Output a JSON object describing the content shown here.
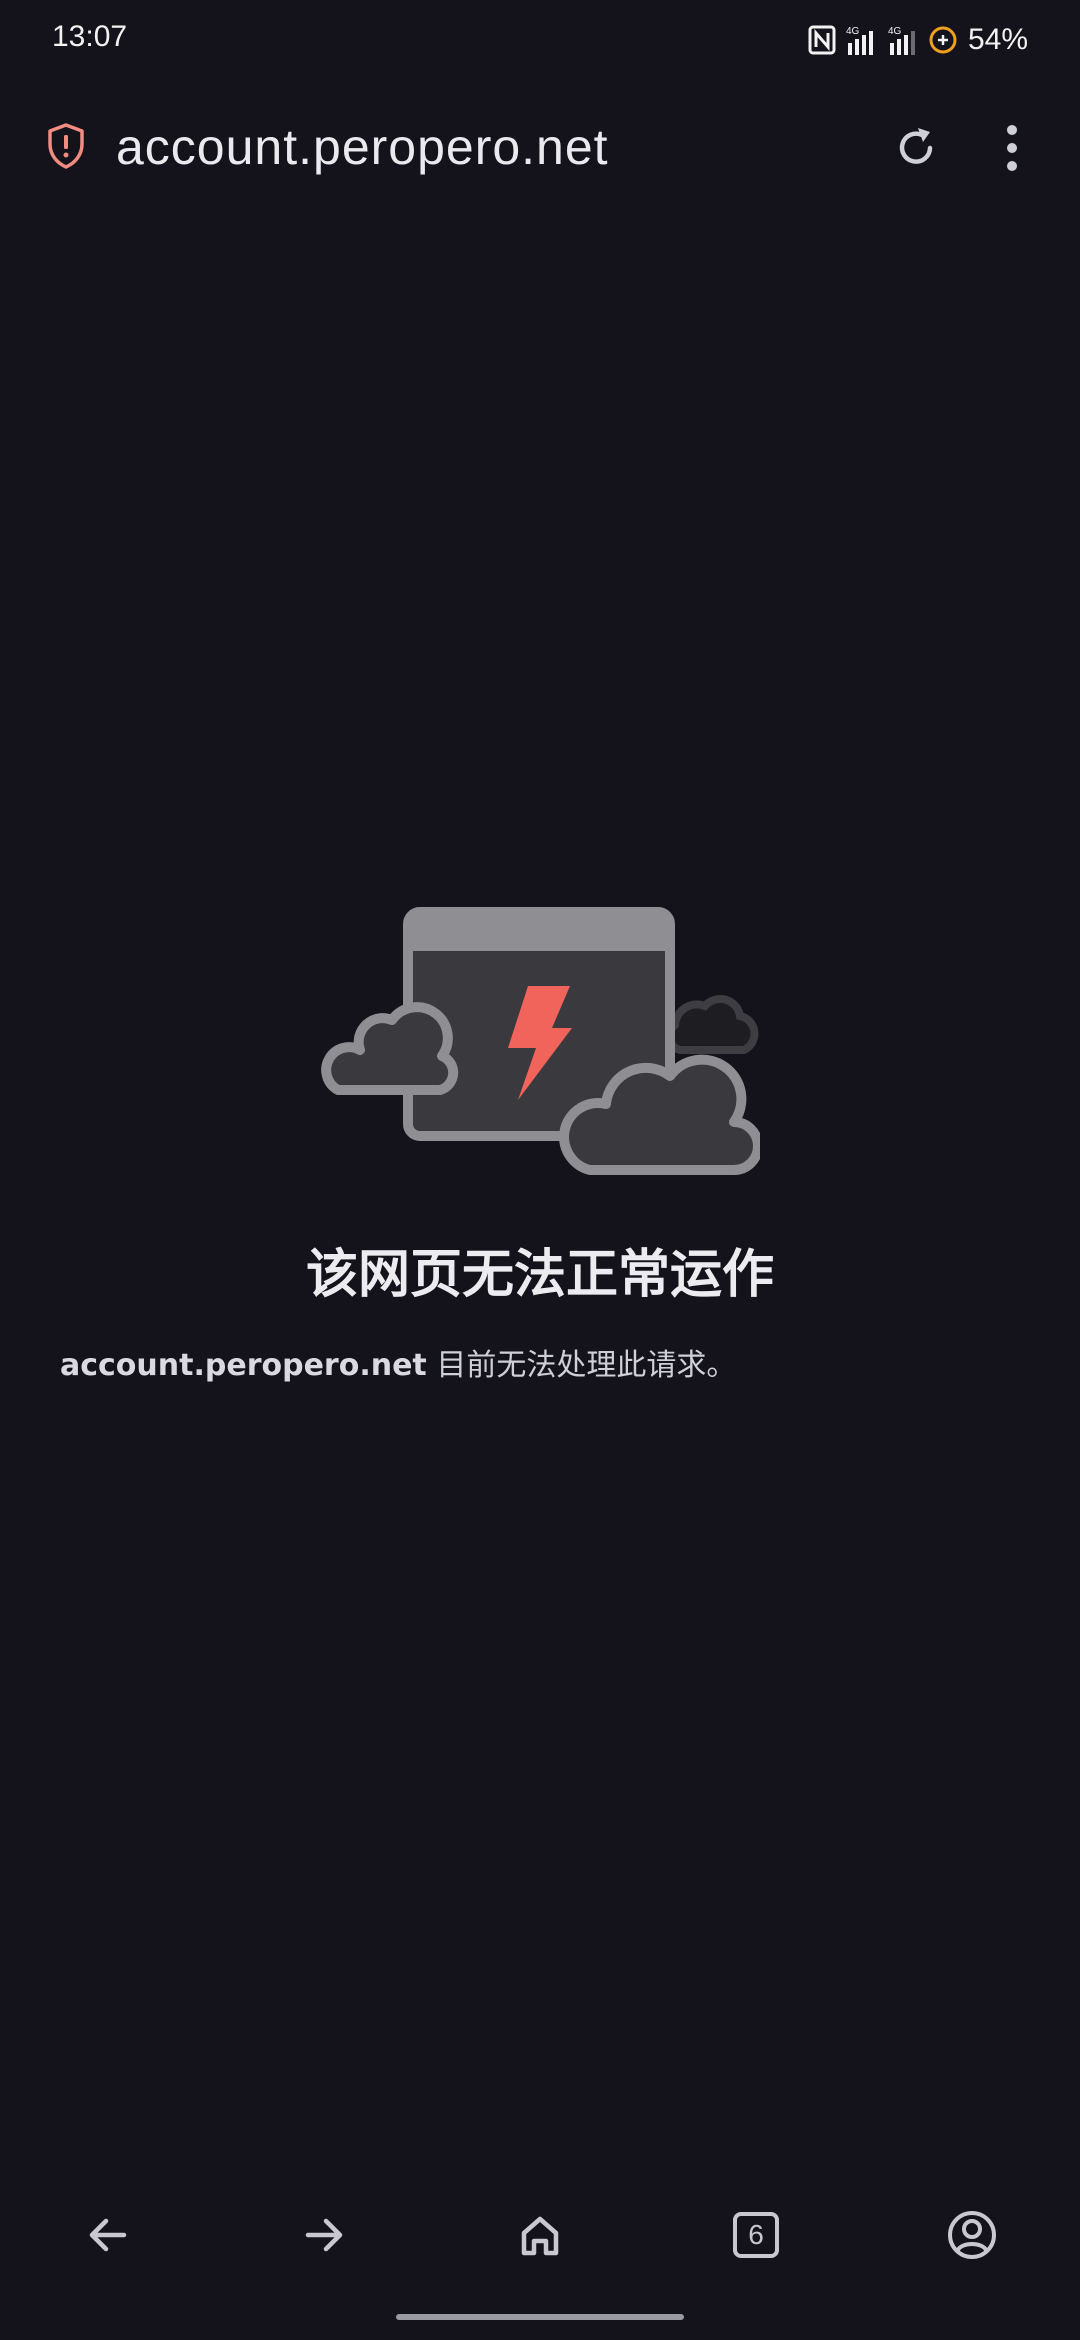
{
  "status_bar": {
    "time": "13:07",
    "battery": "54%",
    "icons": [
      "nfc-icon",
      "signal-4g-icon",
      "signal-4g-icon",
      "battery-saver-icon"
    ]
  },
  "toolbar": {
    "url": "account.peropero.net",
    "icons": [
      "shield-warning-icon",
      "reload-icon",
      "more-vert-icon"
    ]
  },
  "error": {
    "title": "该网页无法正常运作",
    "host": "account.peropero.net",
    "message": " 目前无法处理此请求。"
  },
  "bottom_nav": {
    "tab_count": "6",
    "icons": [
      "back-arrow-icon",
      "forward-arrow-icon",
      "home-icon",
      "tabs-icon",
      "account-icon"
    ]
  },
  "colors": {
    "background": "#14131b",
    "bolt": "#f0645c",
    "shield": "#f28b82"
  }
}
